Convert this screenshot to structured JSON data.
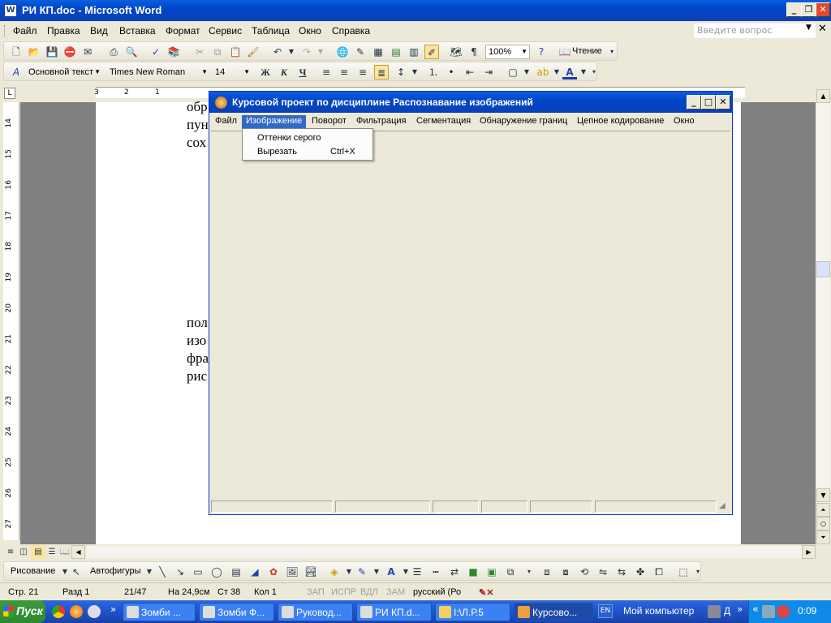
{
  "window": {
    "title": "РИ КП.doc - Microsoft Word"
  },
  "menu": [
    "Файл",
    "Правка",
    "Вид",
    "Вставка",
    "Формат",
    "Сервис",
    "Таблица",
    "Окно",
    "Справка"
  ],
  "help_box": {
    "placeholder": "Введите вопрос"
  },
  "standard_toolbar": {
    "zoom": "100%",
    "reading_label": "Чтение"
  },
  "format_toolbar": {
    "style": "Основной текст",
    "font": "Times New Roman",
    "size": "14",
    "bold": "Ж",
    "italic": "К",
    "underline": "Ч"
  },
  "ruler": {
    "h_ticks": [
      "3",
      "2",
      "1"
    ],
    "v_ticks": [
      "14",
      "15",
      "16",
      "17",
      "18",
      "19",
      "20",
      "21",
      "22",
      "23",
      "24",
      "25",
      "26",
      "27"
    ]
  },
  "document": {
    "lines_top": [
      "обр",
      "пун",
      "сох"
    ],
    "lines_bottom": [
      "пол",
      "изо",
      "фра",
      "рис"
    ]
  },
  "app": {
    "title": "Курсовой проект по дисциплине Распознавание изображений",
    "menu": [
      "Файл",
      "Изображение",
      "Поворот",
      "Фильтрация",
      "Сегментация",
      "Обнаружение границ",
      "Цепное кодирование",
      "Окно"
    ],
    "dropdown": [
      {
        "label": "Оттенки серого",
        "shortcut": ""
      },
      {
        "label": "Вырезать",
        "shortcut": "Ctrl+X"
      }
    ]
  },
  "drawing_toolbar": {
    "draw_label": "Рисование",
    "autoshapes_label": "Автофигуры"
  },
  "status": {
    "page": "Стр. 21",
    "section": "Разд 1",
    "pages": "21/47",
    "at": "На 24,9см",
    "line": "Ст 38",
    "col": "Кол 1",
    "rec": "ЗАП",
    "trk": "ИСПР",
    "ext": "ВДЛ",
    "ovr": "ЗАМ",
    "lang": "русский (Ро"
  },
  "taskbar": {
    "start": "Пуск",
    "tasks": [
      "Зомби ...",
      "Зомби Ф...",
      "Руковод...",
      "РИ КП.d...",
      "I:\\Л.Р.5",
      "Курсово..."
    ],
    "lang": "EN",
    "my_computer": "Мой компьютер",
    "d_label": "Д",
    "clock": "0:09"
  }
}
